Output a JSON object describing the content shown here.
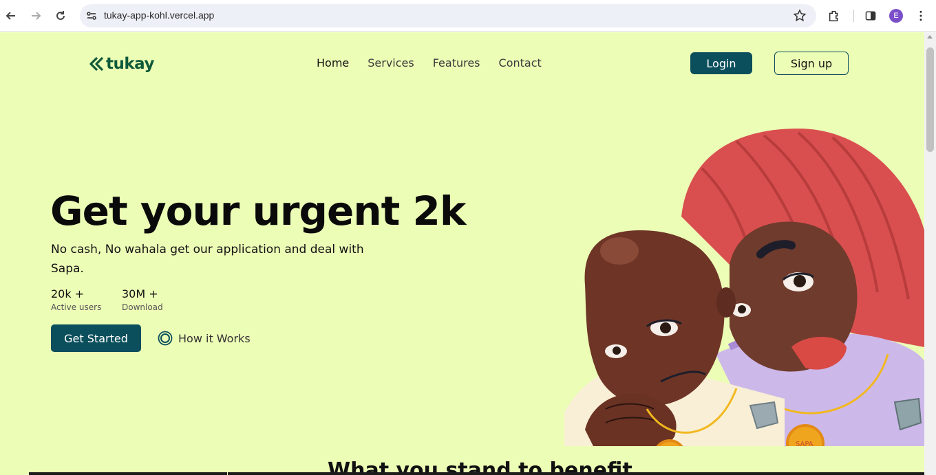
{
  "browser": {
    "url": "tukay-app-kohl.vercel.app",
    "profile_initial": "E",
    "icons": [
      "back-arrow-icon",
      "forward-arrow-icon",
      "reload-icon",
      "site-settings-icon",
      "star-icon",
      "extensions-icon",
      "side-panel-icon",
      "kebab-menu-icon"
    ]
  },
  "brand": {
    "name": "tukay",
    "color": "#0e5a3a"
  },
  "nav": {
    "links": [
      "Home",
      "Services",
      "Features",
      "Contact"
    ],
    "login_label": "Login",
    "signup_label": "Sign up"
  },
  "hero": {
    "title": "Get your urgent 2k",
    "subtitle": "No cash, No wahala get our application and deal with Sapa.",
    "stats": [
      {
        "value": "20k +",
        "label": "Active users"
      },
      {
        "value": "30M +",
        "label": "Download"
      }
    ],
    "cta_label": "Get Started",
    "secondary_label": "How it Works"
  },
  "illustration": {
    "medal_text": "SAPA"
  },
  "next_section": {
    "heading": "What you stand to benefit"
  },
  "colors": {
    "page_bg": "#ecfdb6",
    "accent": "#0b4f5c",
    "brand": "#0e5a3a"
  }
}
